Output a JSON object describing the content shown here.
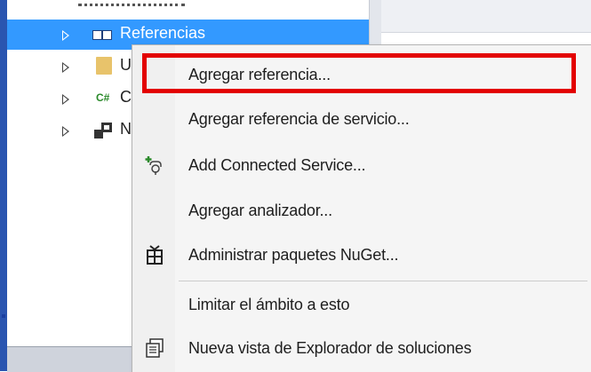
{
  "tree": {
    "items": [
      {
        "label": "Referencias",
        "selected": true,
        "icon": "references-icon"
      },
      {
        "label": "U",
        "icon": "folder-icon"
      },
      {
        "label": "C",
        "icon": "csharp-icon",
        "icon_text": "C#"
      },
      {
        "label": "N",
        "icon": "project-icon"
      }
    ]
  },
  "context_menu": {
    "items": [
      {
        "label": "Agregar referencia...",
        "highlighted": true
      },
      {
        "label": "Agregar referencia de servicio..."
      },
      {
        "label": "Add Connected Service...",
        "icon": "connected-service-icon"
      },
      {
        "label": "Agregar analizador..."
      },
      {
        "label": "Administrar paquetes NuGet...",
        "icon": "nuget-package-icon"
      },
      {
        "label": "Limitar el ámbito a esto"
      },
      {
        "label": "Nueva vista de Explorador de soluciones",
        "icon": "new-explorer-view-icon"
      }
    ]
  },
  "colors": {
    "selection": "#3399ff",
    "highlight_box": "#e30000",
    "menu_background": "#f5f5f5",
    "csharp": "#2b8a2b"
  }
}
